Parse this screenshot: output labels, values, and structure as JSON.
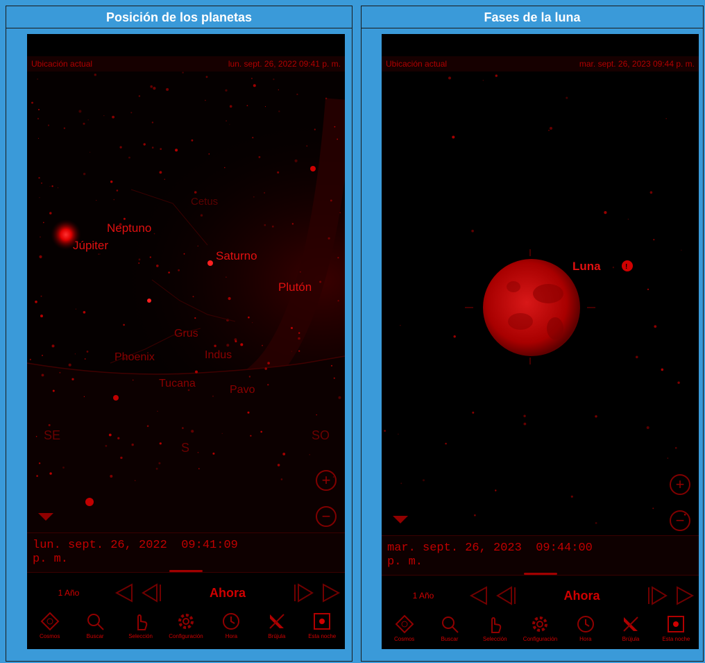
{
  "left": {
    "title": "Posición de los planetas",
    "status_left": "Ubicación actual",
    "status_right": "lun. sept. 26, 2022  09:41 p. m.",
    "time_display": "lun. sept. 26, 2022  09:41:09\np. m.",
    "labels": {
      "neptuno": "Neptuno",
      "jupiter": "Júpiter",
      "saturno": "Saturno",
      "pluton": "Plutón",
      "cetus": "Cetus",
      "grus": "Grus",
      "phoenix": "Phoenix",
      "indus": "Indus",
      "tucana": "Tucana",
      "pavo": "Pavo",
      "se": "SE",
      "s": "S",
      "so": "SO"
    }
  },
  "right": {
    "title": "Fases de la luna",
    "status_left": "Ubicación actual",
    "status_right": "mar. sept. 26, 2023  09:44 p. m.",
    "time_display": "mar. sept. 26, 2023  09:44:00\np. m.",
    "labels": {
      "luna": "Luna"
    }
  },
  "controls": {
    "speed": "1 Año",
    "now": "Ahora"
  },
  "toolbar": [
    "Cosmos",
    "Buscar",
    "Selección",
    "Configuración",
    "Hora",
    "Brújula",
    "Esta noche"
  ],
  "icons": [
    "cosmos-icon",
    "search-icon",
    "selection-hand-icon",
    "gear-icon",
    "clock-icon",
    "compass-icon",
    "tonight-icon"
  ],
  "colors": {
    "frame": "#3a9ad9",
    "night_red": "#e01010",
    "background": "#000000"
  }
}
